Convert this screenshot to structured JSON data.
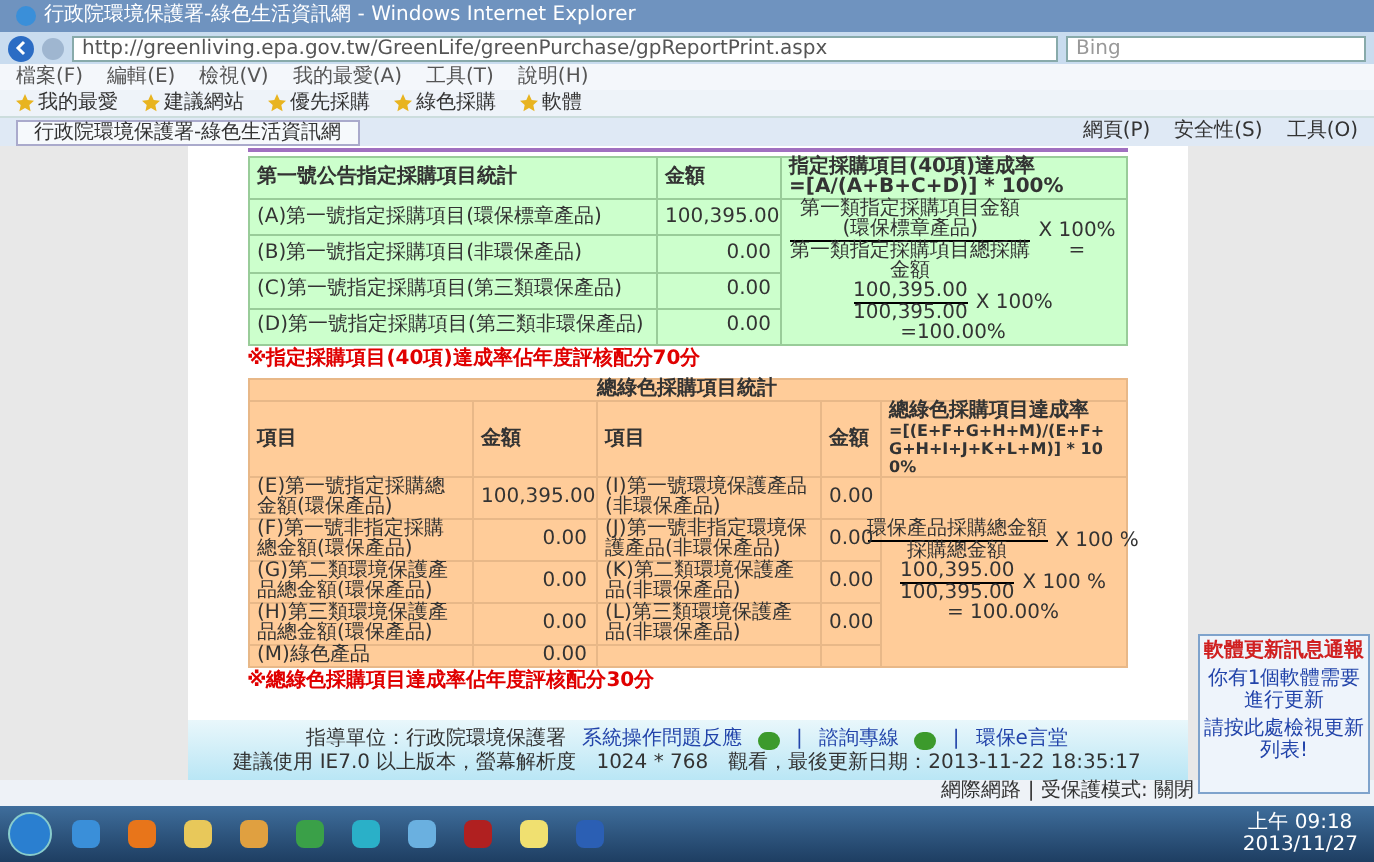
{
  "browser": {
    "title": "行政院環境保護署-綠色生活資訊網 - Windows Internet Explorer",
    "address": "http://greenliving.epa.gov.tw/GreenLife/greenPurchase/gpReportPrint.aspx",
    "search_placeholder": "Bing",
    "menu": [
      "檔案(F)",
      "編輯(E)",
      "檢視(V)",
      "我的最愛(A)",
      "工具(T)",
      "說明(H)"
    ],
    "favorites": [
      "我的最愛",
      "建議網站",
      "優先採購",
      "綠色採購",
      "軟體"
    ],
    "tab": "行政院環境保護署-綠色生活資訊網",
    "toolbar": [
      "網頁(P)",
      "安全性(S)",
      "工具(O)"
    ]
  },
  "green_table": {
    "columns": [
      "第一號公告指定採購項目統計",
      "金額"
    ],
    "rate_title": "指定採購項目(40項)達成率",
    "rate_formula": "=[A/(A+B+C+D)] * 100%",
    "rows": [
      {
        "label": "(A)第一號指定採購項目(環保標章產品)",
        "amount": "100,395.00"
      },
      {
        "label": "(B)第一號指定採購項目(非環保產品)",
        "amount": "0.00"
      },
      {
        "label": "(C)第一號指定採購項目(第三類環保產品)",
        "amount": "0.00"
      },
      {
        "label": "(D)第一號指定採購項目(第三類非環保產品)",
        "amount": "0.00"
      }
    ],
    "numerator": "第一類指定採購項目金額(環保標章產品)",
    "denominator": "第一類指定採購項目總採購金額",
    "times": "X 100%",
    "equals": "=",
    "value_num": "100,395.00",
    "value_den": "100,395.00",
    "times2": "X 100%",
    "result": "=100.00%"
  },
  "green_note": "※指定採購項目(40項)達成率佔年度評核配分70分",
  "orange_table": {
    "title": "總綠色採購項目統計",
    "columns": [
      "項目",
      "金額",
      "項目",
      "金額"
    ],
    "rate_title": "總綠色採購項目達成率",
    "rate_formula": "=[(E+F+G+H+M)/(E+F+G+H+I+J+K+L+M)] * 100%",
    "rows": [
      {
        "item1": "(E)第一號指定採購總金額(環保產品)",
        "amount1": "100,395.00",
        "item2": "(I)第一號環境保護產品(非環保產品)",
        "amount2": "0.00"
      },
      {
        "item1": "(F)第一號非指定採購總金額(環保產品)",
        "amount1": "0.00",
        "item2": "(J)第一號非指定環境保護產品(非環保產品)",
        "amount2": "0.00"
      },
      {
        "item1": "(G)第二類環境保護產品總金額(環保產品)",
        "amount1": "0.00",
        "item2": "(K)第二類環境保護產品(非環保產品)",
        "amount2": "0.00"
      },
      {
        "item1": "(H)第三類環境保護產品總金額(環保產品)",
        "amount1": "0.00",
        "item2": "(L)第三類環境保護產品(非環保產品)",
        "amount2": "0.00"
      },
      {
        "item1": "(M)綠色產品",
        "amount1": "0.00"
      }
    ],
    "numerator": "環保產品採購總金額",
    "denominator": "採購總金額",
    "times": "X 100 %",
    "value_num": "100,395.00",
    "value_den": "100,395.00",
    "times2": "X 100 %",
    "result": "= 100.00%"
  },
  "orange_note": "※總綠色採購項目達成率佔年度評核配分30分",
  "footer": {
    "agency": "指導單位：行政院環境保護署",
    "links": [
      "系統操作問題反應",
      "諮詢專線",
      "環保e言堂"
    ],
    "separator": "|",
    "info": "建議使用 IE7.0 以上版本，螢幕解析度　1024 * 768　觀看，最後更新日期：2013-11-22 18:35:17"
  },
  "status_bar": "網際網路 | 受保護模式: 關閉",
  "popup": {
    "title": "軟體更新訊息通報",
    "lines": [
      "你有1個軟體需要進行更新",
      "請按此處檢視更新列表!"
    ]
  },
  "taskbar": {
    "time": "上午 09:18",
    "date": "2013/11/27"
  }
}
